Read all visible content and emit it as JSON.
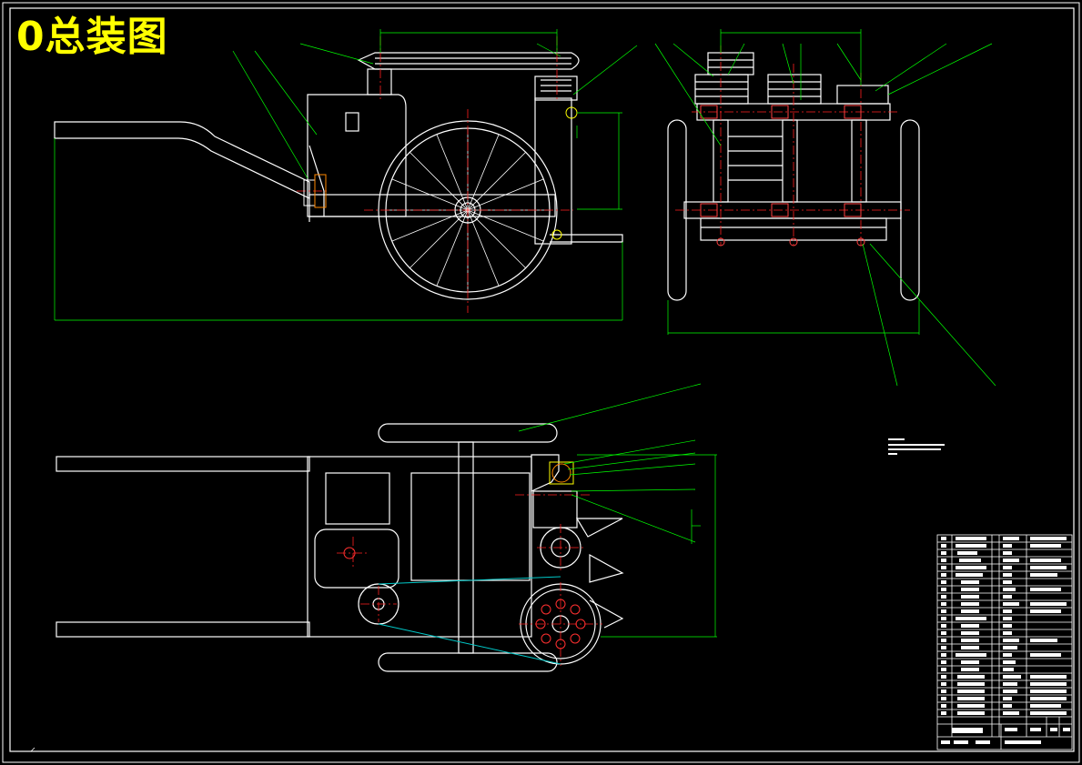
{
  "drawing": {
    "title": "0总装图"
  },
  "colors": {
    "background": "#000000",
    "outline": "#ffffff",
    "centerline": "#ff2020",
    "leader": "#00ff00",
    "hidden": "#00c8c8",
    "dimension": "#00ff00",
    "title_text": "#ffff00",
    "highlight": "#ffff00"
  },
  "views": [
    {
      "name": "front-elevation"
    },
    {
      "name": "side-elevation"
    },
    {
      "name": "plan-view"
    }
  ]
}
